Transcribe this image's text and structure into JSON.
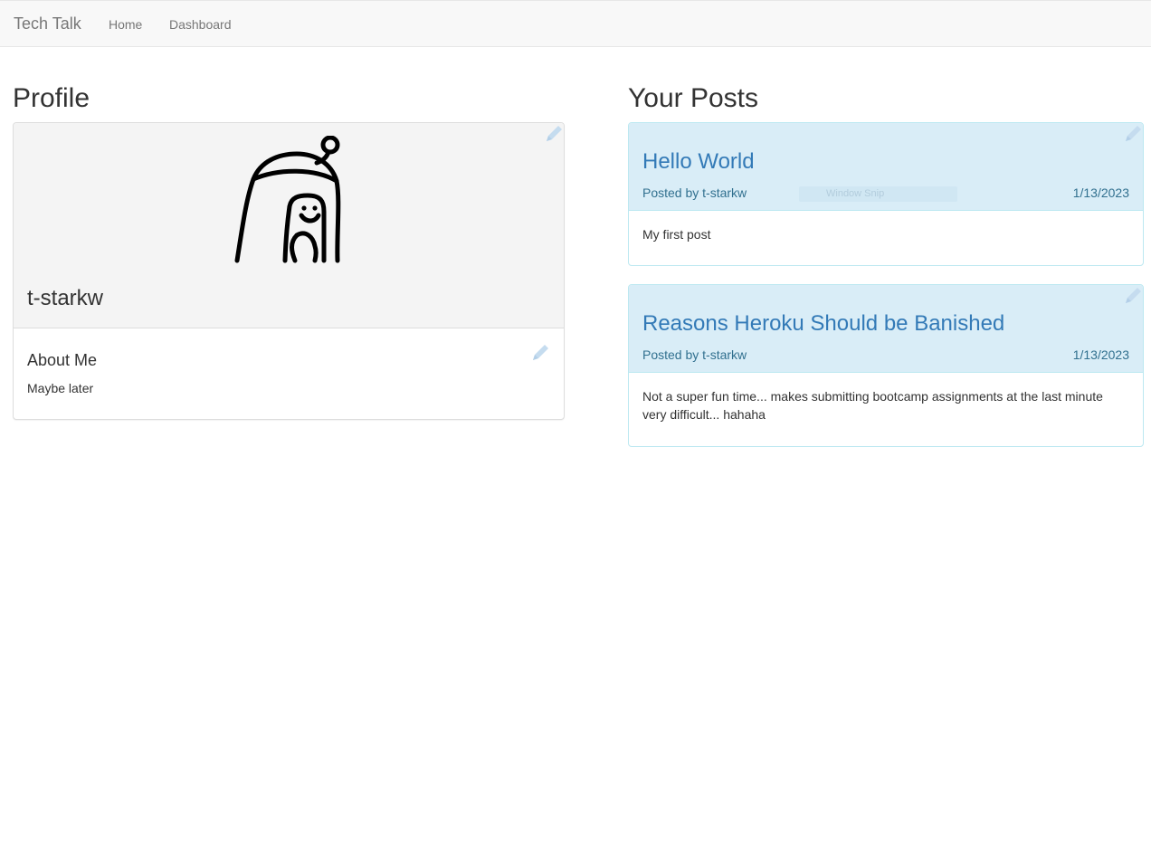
{
  "navbar": {
    "brand": "Tech Talk",
    "links": [
      "Home",
      "Dashboard"
    ]
  },
  "profile": {
    "heading": "Profile",
    "username": "t-starkw",
    "about_title": "About Me",
    "about_text": "Maybe later"
  },
  "posts": {
    "heading": "Your Posts",
    "items": [
      {
        "title": "Hello World",
        "meta": "Posted by t-starkw",
        "date": "1/13/2023",
        "body": "My first post"
      },
      {
        "title": "Reasons Heroku Should be Banished",
        "meta": "Posted by t-starkw",
        "date": "1/13/2023",
        "body": "Not a super fun time... makes submitting bootcamp assignments at the last minute very difficult... hahaha"
      }
    ]
  },
  "overlay": {
    "ghost_label": "Window Snip"
  },
  "icons": {
    "edit": "pencil-icon",
    "avatar": "character-avatar-icon"
  },
  "colors": {
    "navbar_bg": "#f8f8f8",
    "post_header_bg": "#d9edf7",
    "post_title": "#337ab7",
    "edit_icon": "#c5dcef"
  }
}
